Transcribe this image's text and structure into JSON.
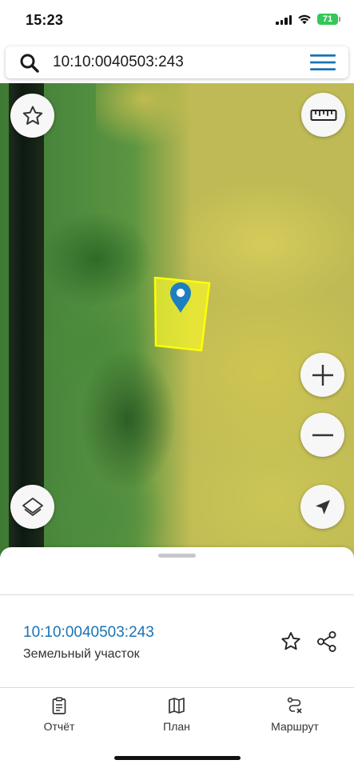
{
  "status_bar": {
    "time": "15:23",
    "battery_level": "71",
    "icons": [
      "signal-icon",
      "wifi-icon",
      "battery-icon"
    ]
  },
  "search": {
    "query": "10:10:0040503:243",
    "icons": [
      "search-icon",
      "menu-icon"
    ]
  },
  "map": {
    "controls": [
      "favorite-icon",
      "ruler-icon",
      "zoom-in-icon",
      "zoom-out-icon",
      "layers-icon",
      "locate-icon"
    ],
    "marker": "location-pin-icon",
    "colors": {
      "parcel_fill": "#f2f22e",
      "parcel_border": "#ffff00",
      "pin": "#1d7fc0"
    }
  },
  "info": {
    "parcel_id": "10:10:0040503:243",
    "parcel_type": "Земельный участок",
    "icons": [
      "favorite-outline-icon",
      "share-icon"
    ],
    "colors": {
      "link": "#1a73b4"
    }
  },
  "tabs": [
    {
      "label": "Отчёт",
      "icon": "report-icon"
    },
    {
      "label": "План",
      "icon": "map-plan-icon"
    },
    {
      "label": "Маршрут",
      "icon": "route-icon"
    }
  ]
}
